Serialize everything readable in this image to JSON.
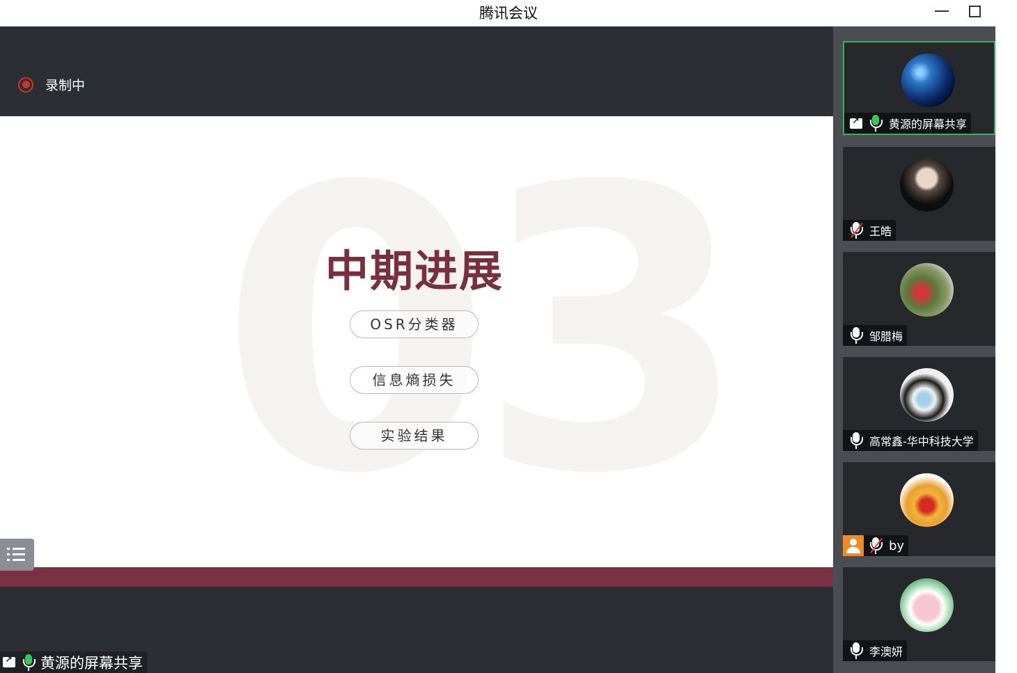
{
  "window": {
    "title": "腾讯会议",
    "controls": [
      "minimize",
      "maximize"
    ]
  },
  "stage": {
    "recording_label": "录制中",
    "share_label": "黄源的屏幕共享",
    "slide": {
      "background_number": "03",
      "heading": "中期进展",
      "items": [
        "OSR分类器",
        "信息熵损失",
        "实验结果"
      ]
    }
  },
  "participants": [
    {
      "name": "黄源的屏幕共享",
      "mic": "active",
      "sharing": true,
      "avatar": "night-sky-avatar"
    },
    {
      "name": "王皓",
      "mic": "muted",
      "avatar": "person-photo-avatar"
    },
    {
      "name": "邹腊梅",
      "mic": "on",
      "avatar": "flowers-avatar"
    },
    {
      "name": "高常鑫-华中科技大学",
      "mic": "on",
      "avatar": "masked-face-avatar"
    },
    {
      "name": "by",
      "mic": "muted",
      "no_video": true,
      "avatar": "ox-mascot-avatar"
    },
    {
      "name": "李澳妍",
      "mic": "on",
      "avatar": "cartoon-pig-avatar"
    }
  ],
  "colors": {
    "accent_wine": "#7a2f3f",
    "recording_red": "#d0332d",
    "active_green": "#2fb55a",
    "mic_green": "#34c759"
  }
}
